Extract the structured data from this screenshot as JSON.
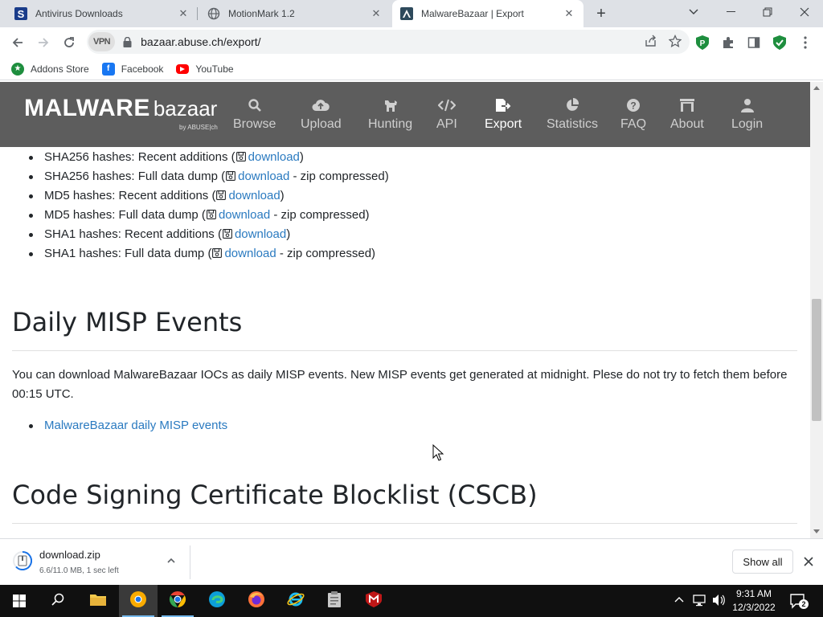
{
  "browser": {
    "tabs": [
      {
        "title": "Antivirus Downloads",
        "icon": "s-letter-icon",
        "active": false
      },
      {
        "title": "MotionMark 1.2",
        "icon": "globe-icon",
        "active": false
      },
      {
        "title": "MalwareBazaar | Export",
        "icon": "malwarebazaar-icon",
        "active": true
      }
    ],
    "url": "bazaar.abuse.ch/export/",
    "vpn_label": "VPN",
    "bookmarks": [
      {
        "label": "Addons Store",
        "icon": "addons-store-icon"
      },
      {
        "label": "Facebook",
        "icon": "facebook-icon"
      },
      {
        "label": "YouTube",
        "icon": "youtube-icon"
      }
    ]
  },
  "site": {
    "logo_main": "MALWARE",
    "logo_sub": "bazaar",
    "logo_by": "by ABUSE|ch",
    "nav": [
      {
        "label": "Browse",
        "icon": "search-icon",
        "active": false
      },
      {
        "label": "Upload",
        "icon": "cloud-upload-icon",
        "active": false
      },
      {
        "label": "Hunting",
        "icon": "dog-icon",
        "active": false
      },
      {
        "label": "API",
        "icon": "code-icon",
        "active": false
      },
      {
        "label": "Export",
        "icon": "file-export-icon",
        "active": true
      },
      {
        "label": "Statistics",
        "icon": "pie-chart-icon",
        "active": false
      },
      {
        "label": "FAQ",
        "icon": "question-circle-icon",
        "active": false
      },
      {
        "label": "About",
        "icon": "building-icon",
        "active": false
      },
      {
        "label": "Login",
        "icon": "user-icon",
        "active": false
      }
    ]
  },
  "content": {
    "hash_list": [
      {
        "prefix": "SHA256 hashes: Recent additions (",
        "link": "download",
        "suffix": ")"
      },
      {
        "prefix": "SHA256 hashes: Full data dump (",
        "link": "download",
        "suffix": " - zip compressed)"
      },
      {
        "prefix": "MD5 hashes: Recent additions (",
        "link": "download",
        "suffix": ")"
      },
      {
        "prefix": "MD5 hashes: Full data dump (",
        "link": "download",
        "suffix": " - zip compressed)"
      },
      {
        "prefix": "SHA1 hashes: Recent additions (",
        "link": "download",
        "suffix": ")"
      },
      {
        "prefix": "SHA1 hashes: Full data dump (",
        "link": "download",
        "suffix": " - zip compressed)"
      }
    ],
    "misp_heading": "Daily MISP Events",
    "misp_paragraph": "You can download MalwareBazaar IOCs as daily MISP events. New MISP events get generated at midnight. Plese do not try to fetch them before 00:15 UTC.",
    "misp_link": "MalwareBazaar daily MISP events",
    "cscb_heading": "Code Signing Certificate Blocklist (CSCB)"
  },
  "download_bar": {
    "filename": "download.zip",
    "status": "6.6/11.0 MB, 1 sec left",
    "show_all": "Show all"
  },
  "taskbar": {
    "apps": [
      "file-explorer-icon",
      "chrome-canary-icon",
      "chrome-icon",
      "edge-icon",
      "firefox-icon",
      "internet-explorer-icon",
      "clipboard-app-icon",
      "mcafee-icon"
    ],
    "time": "9:31 AM",
    "date": "12/3/2022",
    "notifications": "2"
  },
  "colors": {
    "site_nav_bg": "#5d5d5d",
    "link": "#2a7ac0",
    "taskbar_bg": "#101010"
  }
}
